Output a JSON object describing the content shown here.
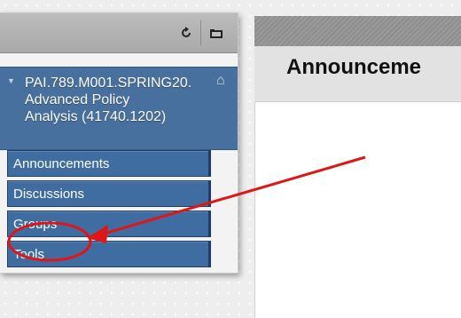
{
  "toolbar": {
    "refresh_icon": "refresh-icon",
    "folder_icon": "folder-view-icon"
  },
  "course": {
    "title_line1": "PAI.789.M001.SPRING20.",
    "title_line2": "Advanced Policy",
    "title_line3": "Analysis (41740.1202)"
  },
  "nav": {
    "items": [
      {
        "label": "Announcements"
      },
      {
        "label": "Discussions"
      },
      {
        "label": "Groups"
      },
      {
        "label": "Tools"
      }
    ]
  },
  "content": {
    "title": "Announceme"
  },
  "colors": {
    "menu_item_blue": "#3f6ca1",
    "course_header_blue": "#48709f",
    "annotation_red": "#e01515"
  }
}
